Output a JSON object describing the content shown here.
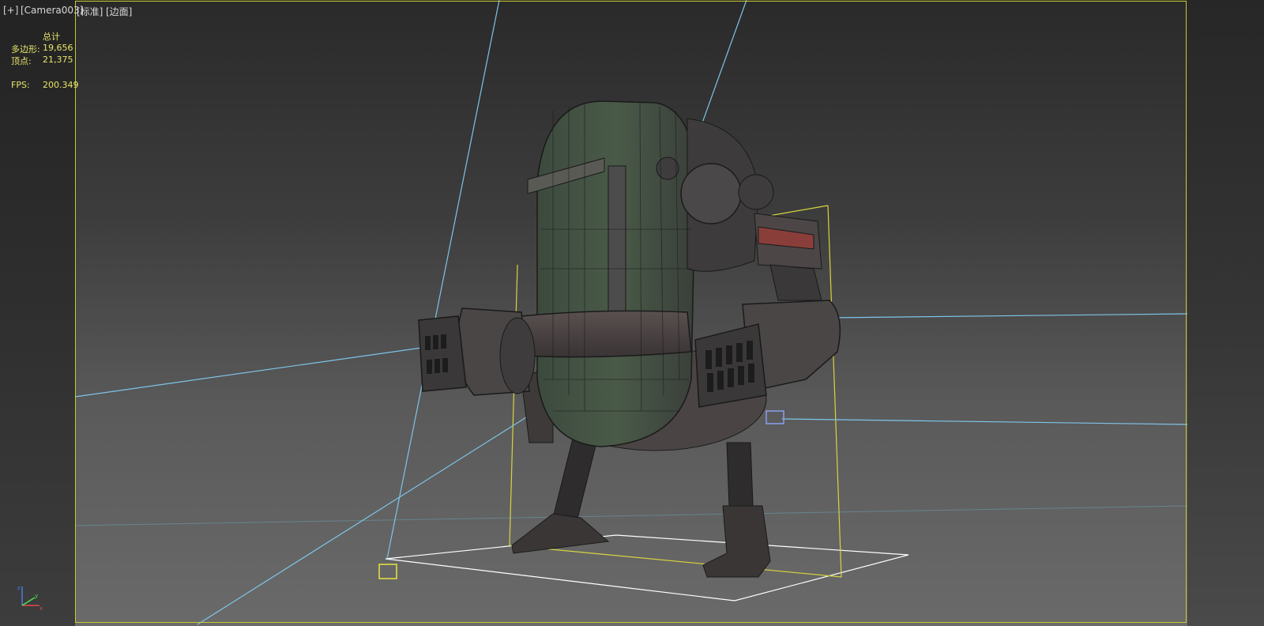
{
  "viewport": {
    "menu_label": "[+]",
    "camera_label": "[Camera003]",
    "shading_label": "[标准]",
    "display_label": "[边面]"
  },
  "stats": {
    "header": "总计",
    "polygons_label": "多边形:",
    "polygons_value": "19,656",
    "vertices_label": "顶点:",
    "vertices_value": "21,375",
    "fps_label": "FPS:",
    "fps_value": "200.349"
  },
  "colors": {
    "stats_text": "#e8e46a",
    "label_text": "#d8d8d8",
    "safe_frame": "#c8c832",
    "light_lines": "#7ec4e8",
    "ground_grid": "#ffffff",
    "selection_box": "#d8d440"
  },
  "icons": {
    "axis": "xyz-axis-tripod-icon",
    "light_left": "light-gizmo-icon",
    "light_right": "light-gizmo-icon"
  }
}
